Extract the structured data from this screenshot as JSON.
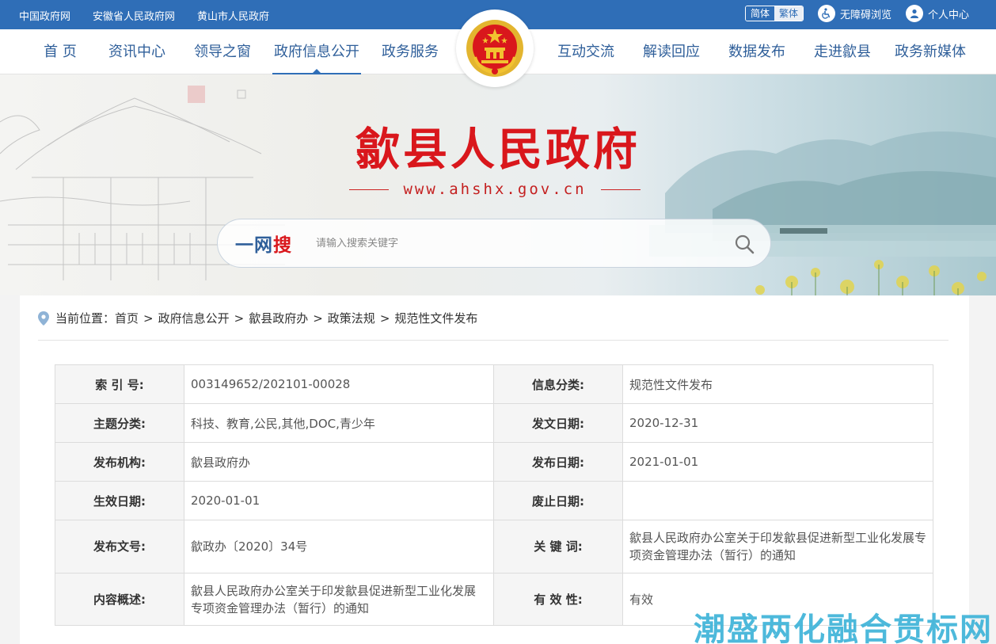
{
  "topbar": {
    "links": [
      "中国政府网",
      "安徽省人民政府网",
      "黄山市人民政府"
    ],
    "lang_simplified": "简体",
    "lang_traditional": "繁体",
    "accessibility": "无障碍浏览",
    "personal_center": "个人中心"
  },
  "nav": {
    "items": [
      "首 页",
      "资讯中心",
      "领导之窗",
      "政府信息公开",
      "政务服务",
      "互动交流",
      "解读回应",
      "数据发布",
      "走进歙县",
      "政务新媒体"
    ]
  },
  "banner": {
    "title": "歙县人民政府",
    "url": "www.ahshx.gov.cn"
  },
  "search": {
    "brand_left": "一网",
    "brand_right": "搜",
    "placeholder": "请输入搜索关键字"
  },
  "breadcrumb": {
    "label": "当前位置：",
    "items": [
      "首页",
      "政府信息公开",
      "歙县政府办",
      "政策法规",
      "规范性文件发布"
    ],
    "separator": ">"
  },
  "meta": {
    "rows": [
      {
        "k1": "索 引 号:",
        "v1": "003149652/202101-00028",
        "k2": "信息分类:",
        "v2": "规范性文件发布"
      },
      {
        "k1": "主题分类:",
        "v1": "科技、教育,公民,其他,DOC,青少年",
        "k2": "发文日期:",
        "v2": "2020-12-31"
      },
      {
        "k1": "发布机构:",
        "v1": "歙县政府办",
        "k2": "发布日期:",
        "v2": "2021-01-01"
      },
      {
        "k1": "生效日期:",
        "v1": "2020-01-01",
        "k2": "废止日期:",
        "v2": ""
      },
      {
        "k1": "发布文号:",
        "v1": "歙政办〔2020〕34号",
        "k2": "关 键 词:",
        "v2": "歙县人民政府办公室关于印发歙县促进新型工业化发展专项资金管理办法（暂行）的通知"
      },
      {
        "k1": "内容概述:",
        "v1": "歙县人民政府办公室关于印发歙县促进新型工业化发展专项资金管理办法（暂行）的通知",
        "k2": "有 效 性:",
        "v2": "有效"
      }
    ]
  },
  "watermark": "潮盛两化融合贯标网",
  "colors": {
    "brand_blue": "#2f6eb7",
    "title_red": "#d9171c"
  },
  "icons": [
    "accessibility-icon",
    "user-icon",
    "national-emblem-icon",
    "search-icon",
    "location-pin-icon"
  ]
}
